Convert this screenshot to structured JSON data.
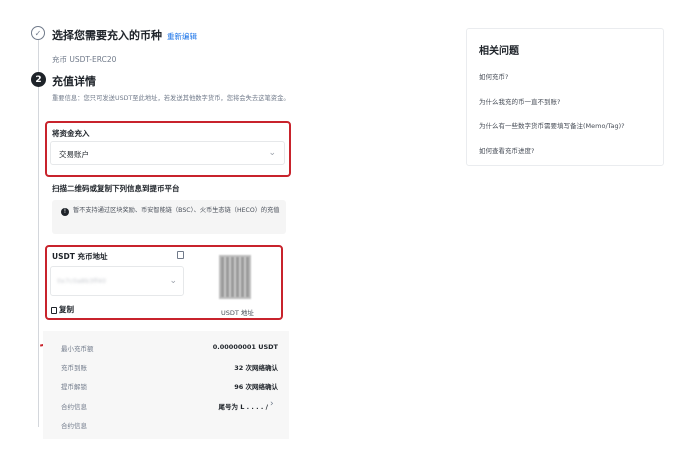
{
  "step1": {
    "number": "✓",
    "title": "选择您需要充入的币种",
    "edit_label": "重新编辑",
    "selected_coin": "充币 USDT-ERC20"
  },
  "step2": {
    "number": "2",
    "title": "充值详情",
    "warning": "重要信息：您只可发送USDT至此地址，若发送其他数字货币，您将会失去这笔资金。",
    "deposit_to": {
      "label": "将资金充入",
      "value": "交易账户"
    },
    "scan_heading": "扫描二维码或复制下列信息到提币平台",
    "network_notice": "暂不支持通过区块奖励、币安智能链（BSC）、火币生态链（HECO）的充值",
    "address": {
      "label": "USDT 充币地址",
      "value": "0x7c0a8b3ff40",
      "copy_label": "复制",
      "qr_caption": "USDT 地址"
    },
    "details": [
      {
        "label": "最小充币额",
        "value": "0.00000001 USDT"
      },
      {
        "label": "充币到账",
        "value": "32 次网络确认"
      },
      {
        "label": "提币解锁",
        "value": "96 次网络确认"
      },
      {
        "label": "合约信息",
        "value": "尾号为 L . . . . /"
      },
      {
        "label": "合约信息",
        "value": ""
      }
    ]
  },
  "sidebar": {
    "title": "相关问题",
    "links": [
      "如何充币?",
      "为什么我充的币一直不到账?",
      "为什么有一些数字货币需要填写备注(Memo/Tag)?",
      "如何查看充币进度?"
    ]
  },
  "colors": {
    "highlight": "#c8232c",
    "link": "#1a73e8",
    "text": "#1e2329",
    "muted": "#707a8a"
  }
}
